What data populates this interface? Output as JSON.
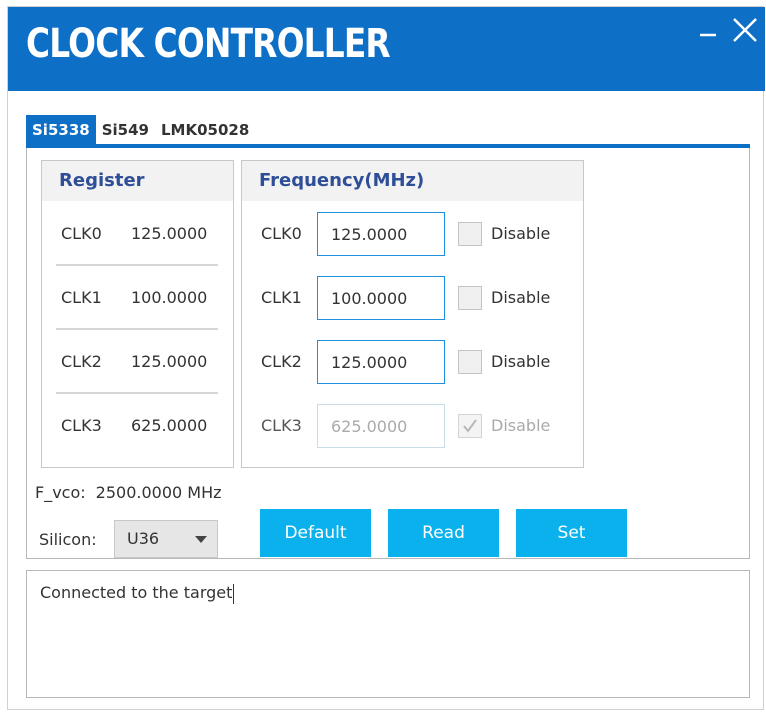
{
  "window": {
    "title": "CLOCK CONTROLLER"
  },
  "tabs": [
    {
      "label": "Si5338",
      "active": true
    },
    {
      "label": "Si549",
      "active": false
    },
    {
      "label": "LMK05028",
      "active": false
    }
  ],
  "register": {
    "header": "Register",
    "rows": [
      {
        "label": "CLK0",
        "value": "125.0000"
      },
      {
        "label": "CLK1",
        "value": "100.0000"
      },
      {
        "label": "CLK2",
        "value": "125.0000"
      },
      {
        "label": "CLK3",
        "value": "625.0000"
      }
    ]
  },
  "frequency": {
    "header": "Frequency(MHz)",
    "rows": [
      {
        "label": "CLK0",
        "value": "125.0000",
        "disable_label": "Disable",
        "checked": false,
        "enabled": true
      },
      {
        "label": "CLK1",
        "value": "100.0000",
        "disable_label": "Disable",
        "checked": false,
        "enabled": true
      },
      {
        "label": "CLK2",
        "value": "125.0000",
        "disable_label": "Disable",
        "checked": false,
        "enabled": true
      },
      {
        "label": "CLK3",
        "value": "625.0000",
        "disable_label": "Disable",
        "checked": true,
        "enabled": false
      }
    ]
  },
  "fvco": {
    "label": "F_vco:",
    "value": "2500.0000 MHz"
  },
  "silicon": {
    "label": "Silicon:",
    "selected": "U36"
  },
  "buttons": {
    "default": "Default",
    "read": "Read",
    "set": "Set"
  },
  "log": {
    "text": "Connected to the target"
  },
  "colors": {
    "titlebar": "#0e6fc7",
    "button": "#0ab1ec",
    "header_text": "#2f4e98"
  }
}
